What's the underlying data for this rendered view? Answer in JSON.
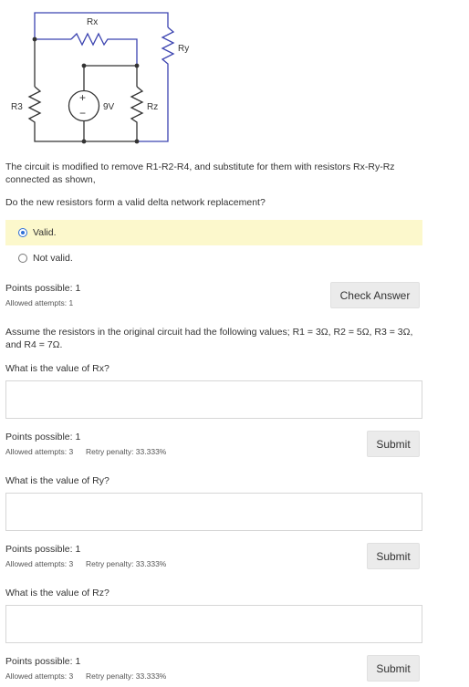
{
  "circuit": {
    "labels": {
      "rx": "Rx",
      "ry": "Ry",
      "rz": "Rz",
      "r3": "R3",
      "source": "9V",
      "plus": "+",
      "minus": "−"
    }
  },
  "question1": {
    "statement": "The circuit is modified to remove R1-R2-R4, and substitute for them with resistors Rx-Ry-Rz connected as shown,",
    "prompt": "Do the new resistors form a valid delta network replacement?",
    "options": [
      {
        "label": "Valid.",
        "selected": true
      },
      {
        "label": "Not valid.",
        "selected": false
      }
    ],
    "points": "Points possible: 1",
    "attempts": "Allowed attempts: 1",
    "button": "Check Answer"
  },
  "given": "Assume the resistors in the original circuit had the following values; R1 = 3Ω, R2 = 5Ω, R3 = 3Ω, and R4 = 7Ω.",
  "parts": [
    {
      "prompt": "What is the value of Rx?",
      "value": "",
      "points": "Points possible: 1",
      "attempts": "Allowed attempts: 3",
      "penalty": "Retry penalty: 33.333%",
      "button": "Submit"
    },
    {
      "prompt": "What is the value of Ry?",
      "value": "",
      "points": "Points possible: 1",
      "attempts": "Allowed attempts: 3",
      "penalty": "Retry penalty: 33.333%",
      "button": "Submit"
    },
    {
      "prompt": "What is the value of Rz?",
      "value": "",
      "points": "Points possible: 1",
      "attempts": "Allowed attempts: 3",
      "penalty": "Retry penalty: 33.333%",
      "button": "Submit"
    }
  ],
  "colors": {
    "wire_blue": "#3b43b0",
    "wire_black": "#333333",
    "highlight": "#fcf8cc",
    "radio_accent": "#2f6fd6",
    "button_bg": "#ebebeb"
  }
}
